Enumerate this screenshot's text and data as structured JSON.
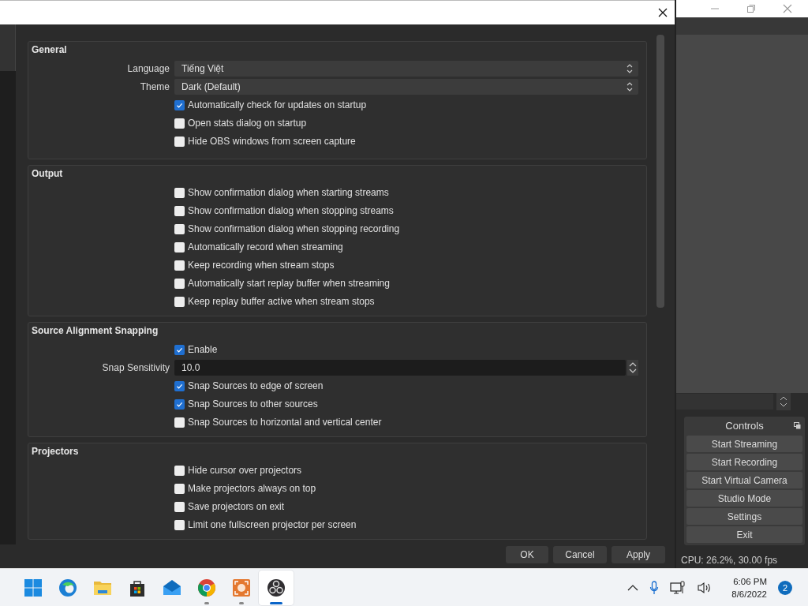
{
  "dialog": {
    "sections": [
      {
        "title": "General",
        "rows": [
          {
            "kind": "select",
            "label": "Language",
            "value": "Tiếng Việt"
          },
          {
            "kind": "select",
            "label": "Theme",
            "value": "Dark (Default)"
          },
          {
            "kind": "checkbox",
            "label": "Automatically check for updates on startup",
            "checked": true
          },
          {
            "kind": "checkbox",
            "label": "Open stats dialog on startup",
            "checked": false
          },
          {
            "kind": "checkbox",
            "label": "Hide OBS windows from screen capture",
            "checked": false
          }
        ]
      },
      {
        "title": "Output",
        "rows": [
          {
            "kind": "checkbox",
            "label": "Show confirmation dialog when starting streams",
            "checked": false
          },
          {
            "kind": "checkbox",
            "label": "Show confirmation dialog when stopping streams",
            "checked": false
          },
          {
            "kind": "checkbox",
            "label": "Show confirmation dialog when stopping recording",
            "checked": false
          },
          {
            "kind": "checkbox",
            "label": "Automatically record when streaming",
            "checked": false
          },
          {
            "kind": "checkbox",
            "label": "Keep recording when stream stops",
            "checked": false
          },
          {
            "kind": "checkbox",
            "label": "Automatically start replay buffer when streaming",
            "checked": false
          },
          {
            "kind": "checkbox",
            "label": "Keep replay buffer active when stream stops",
            "checked": false
          }
        ]
      },
      {
        "title": "Source Alignment Snapping",
        "rows": [
          {
            "kind": "checkbox",
            "label": "Enable",
            "checked": true
          },
          {
            "kind": "spin",
            "label": "Snap Sensitivity",
            "value": "10.0"
          },
          {
            "kind": "checkbox",
            "label": "Snap Sources to edge of screen",
            "checked": true
          },
          {
            "kind": "checkbox",
            "label": "Snap Sources to other sources",
            "checked": true
          },
          {
            "kind": "checkbox",
            "label": "Snap Sources to horizontal and vertical center",
            "checked": false
          }
        ]
      },
      {
        "title": "Projectors",
        "rows": [
          {
            "kind": "checkbox",
            "label": "Hide cursor over projectors",
            "checked": false
          },
          {
            "kind": "checkbox",
            "label": "Make projectors always on top",
            "checked": false
          },
          {
            "kind": "checkbox",
            "label": "Save projectors on exit",
            "checked": false
          },
          {
            "kind": "checkbox",
            "label": "Limit one fullscreen projector per screen",
            "checked": false
          }
        ]
      }
    ],
    "buttons": [
      "OK",
      "Cancel",
      "Apply"
    ]
  },
  "main_window": {
    "dock": {
      "title": "Controls",
      "buttons": [
        "Start Streaming",
        "Start Recording",
        "Start Virtual Camera",
        "Studio Mode",
        "Settings",
        "Exit"
      ]
    },
    "status": "CPU: 26.2%, 30.00 fps"
  },
  "taskbar": {
    "apps": [
      {
        "kind": "start",
        "running": false,
        "active": false
      },
      {
        "kind": "edge",
        "running": false,
        "active": false
      },
      {
        "kind": "folder",
        "running": false,
        "active": false
      },
      {
        "kind": "store",
        "running": false,
        "active": false
      },
      {
        "kind": "mail",
        "running": false,
        "active": false
      },
      {
        "kind": "chrome",
        "running": true,
        "active": false
      },
      {
        "kind": "capture",
        "running": true,
        "active": false
      },
      {
        "kind": "obs",
        "running": true,
        "active": true
      }
    ],
    "time": "6:06 PM",
    "date": "8/6/2022",
    "notifications": "2"
  }
}
